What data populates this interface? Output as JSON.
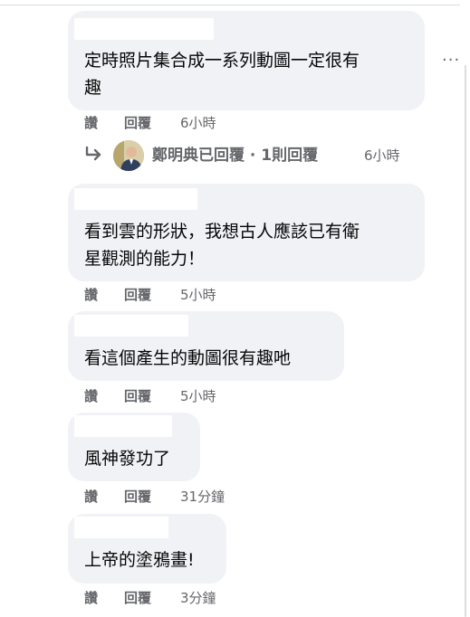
{
  "comments": [
    {
      "text_lines": [
        "定時照片集合成一系列動圖一定很有",
        "趣"
      ],
      "like": "讚",
      "reply": "回覆",
      "time": "6小時"
    },
    {
      "text_lines": [
        "看到雲的形狀，我想古人應該已有衛",
        "星觀測的能力！"
      ],
      "like": "讚",
      "reply": "回覆",
      "time": "5小時"
    },
    {
      "text_lines": [
        "看這個產生的動圖很有趣吔"
      ],
      "like": "讚",
      "reply": "回覆",
      "time": "5小時"
    },
    {
      "text_lines": [
        "風神發功了"
      ],
      "like": "讚",
      "reply": "回覆",
      "time": "31分鐘"
    },
    {
      "text_lines": [
        "上帝的塗鴉畫!"
      ],
      "like": "讚",
      "reply": "回覆",
      "time": "3分鐘"
    }
  ],
  "reply_thread": {
    "label": "鄭明典已回覆 · 1則回覆",
    "time": "6小時"
  },
  "menu": {
    "more_label": "···"
  },
  "icons": {
    "reply_arrow": "reply-arrow-icon",
    "avatar": "avatar"
  },
  "colors": {
    "bubble": "#f0f2f5",
    "meta_text": "#65676b",
    "body_text": "#050505"
  }
}
